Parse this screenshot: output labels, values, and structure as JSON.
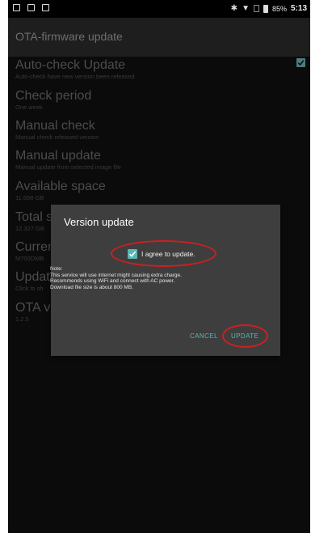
{
  "status_bar": {
    "icons_left": [
      "screenshot-icon",
      "lock-icon",
      "notification-icon"
    ],
    "battery_percent": "85%",
    "time": "5:13"
  },
  "appbar": {
    "title": "OTA-firmware update"
  },
  "settings": [
    {
      "title": "Auto-check Update",
      "summary": "Auto-check have new version been released",
      "checked": true
    },
    {
      "title": "Check period",
      "summary": "One week"
    },
    {
      "title": "Manual check",
      "summary": "Manual check released version"
    },
    {
      "title": "Manual update",
      "summary": "Manual update from selected image file"
    },
    {
      "title": "Available space",
      "summary": "11.698 GB"
    },
    {
      "title": "Total s",
      "summary": "12.327 GB"
    },
    {
      "title": "Curren",
      "summary": "M700DMB"
    },
    {
      "title": "Update",
      "summary": "Click to sh"
    },
    {
      "title": "OTA ve",
      "summary": "1.2.5"
    }
  ],
  "dialog": {
    "title": "Version update",
    "agree_label": "I agree to update.",
    "agree_checked": true,
    "note_lines": [
      "Note:",
      "This service will use internet might causing extra charge.",
      "Recommends using WiFi and connect with AC power.",
      "Download file size is about 800 MB."
    ],
    "cancel_label": "CANCEL",
    "update_label": "UPDATE"
  },
  "colors": {
    "accent": "#5ab6b3",
    "annotation_red": "#cf1f1f",
    "dialog_bg": "#3e3e3e"
  }
}
